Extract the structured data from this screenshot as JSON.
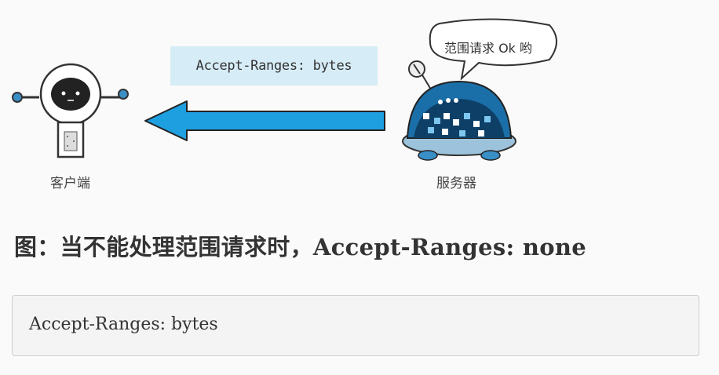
{
  "diagram": {
    "header_label": "Accept-Ranges: bytes",
    "client_label": "客户端",
    "server_label": "服务器",
    "server_bubble": "范围请求 Ok 哟",
    "arrow_direction": "server-to-client",
    "colors": {
      "arrow": "#1e9fe0",
      "header_bg": "#d6ecf7",
      "server_shell": "#1b6fa8"
    }
  },
  "caption": "图：当不能处理范围请求时，Accept-Ranges: none",
  "code_block": {
    "text": "Accept-Ranges: bytes"
  }
}
